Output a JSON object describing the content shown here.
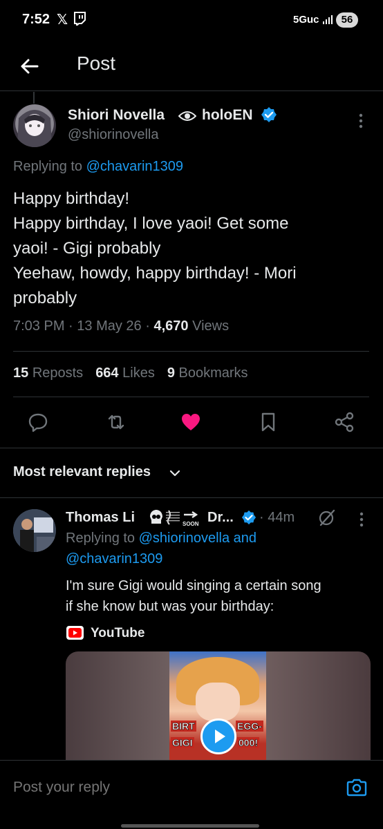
{
  "status_bar": {
    "time": "7:52",
    "x_glyph": "𝕏",
    "network": "5Guc",
    "battery": "56"
  },
  "header": {
    "title": "Post"
  },
  "post": {
    "author_name": "Shiori Novella",
    "author_group": "holoEN",
    "handle": "@shiorinovella",
    "replying_prefix": "Replying to ",
    "replying_to": "@chavarin1309",
    "body_lines": [
      "Happy birthday!",
      "Happy birthday, I love yaoi! Get some",
      "yaoi! - Gigi probably",
      "Yeehaw, howdy, happy birthday! - Mori",
      "probably"
    ],
    "time": "7:03 PM",
    "date": "13 May 26",
    "views_count": "4,670",
    "views_label": "Views",
    "separator": "·",
    "reposts_count": "15",
    "reposts_label": "Reposts",
    "likes_count": "664",
    "likes_label": "Likes",
    "bookmarks_count": "9",
    "bookmarks_label": "Bookmarks"
  },
  "replies_header": {
    "label": "Most relevant replies"
  },
  "reply": {
    "name": "Thomas Li",
    "name_suffix": "Dr...",
    "emoji_soon": "SOON",
    "time": "· 44m",
    "replying_prefix": "Replying to ",
    "replying_to_1": "@shiorinovella",
    "replying_and": " and",
    "replying_to_2": "@chavarin1309",
    "text_lines": [
      "I'm sure Gigi would singing a certain song",
      "if she know but was your birthday:"
    ],
    "card_source": "YouTube",
    "thumb_caption_1": "BIRT",
    "thumb_caption_2": "EGG-",
    "thumb_caption_3": "GIGI",
    "thumb_caption_4": "000!"
  },
  "composer": {
    "placeholder": "Post your reply"
  },
  "colors": {
    "accent": "#1d9bf0",
    "like": "#f91880",
    "muted": "#71767b",
    "text": "#e7e9ea",
    "background": "#000000"
  }
}
